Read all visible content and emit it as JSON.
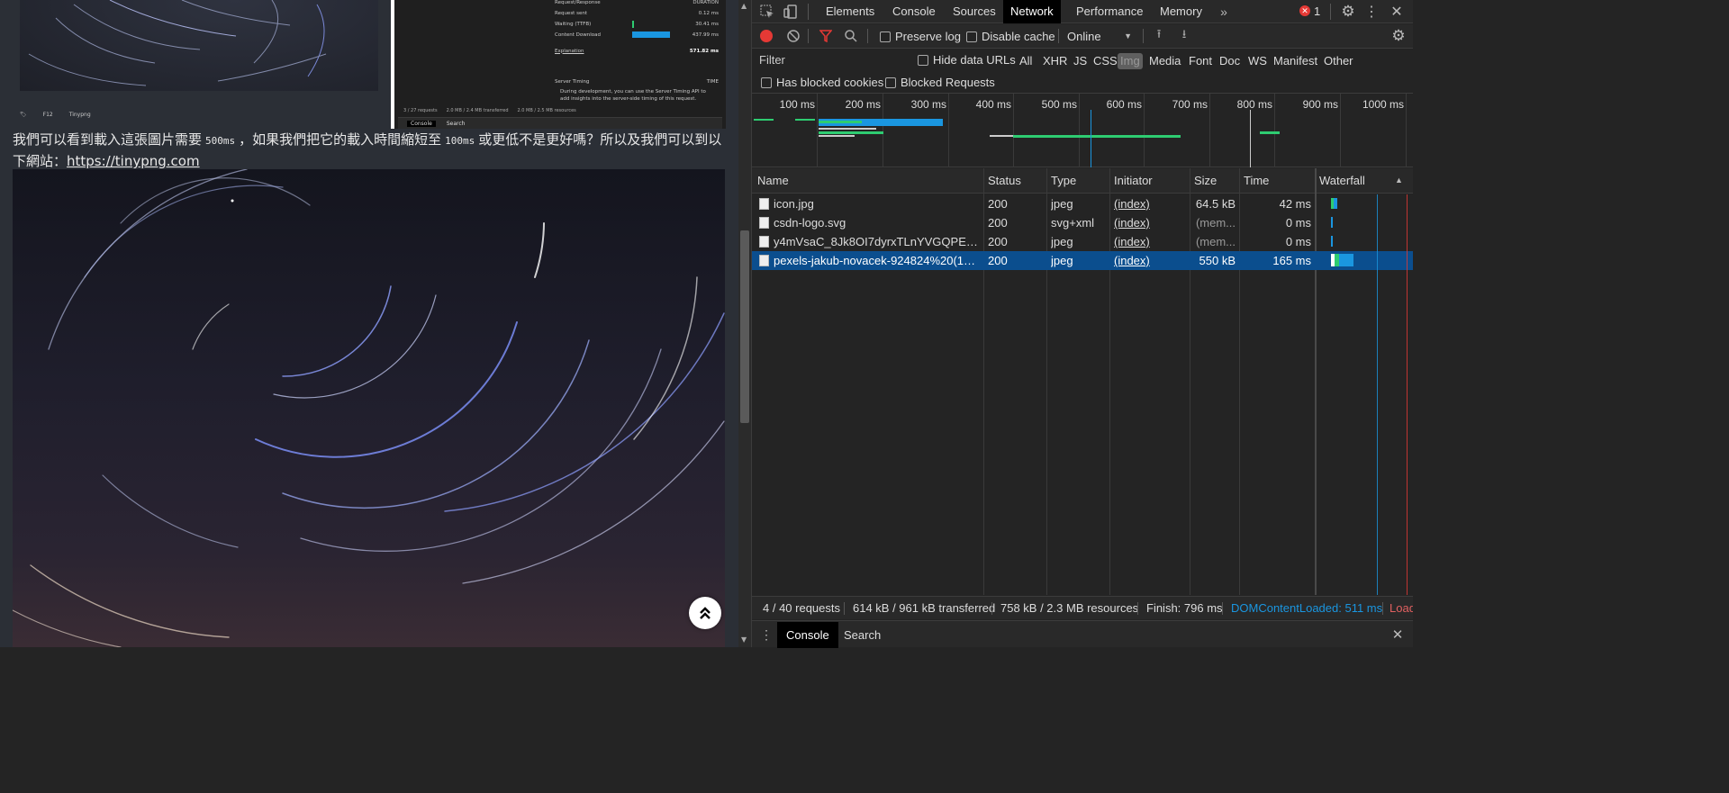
{
  "page": {
    "paragraph": {
      "part1": "我們可以看到載入這張圖片需要",
      "code1": "500ms",
      "part2": "，如果我們把它的載入時間縮短至",
      "code2": "100ms",
      "part3": "或更低不是更好嗎？所以及我們可以到以下網站：",
      "link": "https://tinypng.com"
    },
    "thumb_caption": [
      "F12",
      "Tinypng"
    ],
    "inner_screenshot": {
      "section": "Request/Response",
      "duration_label": "DURATION",
      "rows": [
        {
          "label": "Request sent",
          "value": "0.12 ms",
          "fill": 0.0
        },
        {
          "label": "Waiting (TTFB)",
          "value": "30.41 ms",
          "fill": 0.03
        },
        {
          "label": "Content Download",
          "value": "437.99 ms",
          "fill": 0.48
        }
      ],
      "explanation": "Explanation",
      "total": "571.82 ms",
      "server_timing": "Server Timing",
      "time_label": "TIME",
      "server_note": "During development, you can use the Server Timing API to add insights into the server-side timing of this request.",
      "status": [
        "3 / 27 requests",
        "2.0 MB / 2.4 MB transferred",
        "2.0 MB / 2.5 MB resources"
      ],
      "tabs": [
        "Console",
        "Search"
      ]
    }
  },
  "devtools": {
    "tabs": [
      "Elements",
      "Console",
      "Sources",
      "Network",
      "Performance",
      "Memory"
    ],
    "active_tab": "Network",
    "error_count": "1",
    "toolbar": {
      "preserve_log": "Preserve log",
      "disable_cache": "Disable cache",
      "throttle": "Online"
    },
    "filter": {
      "placeholder": "Filter",
      "hide_data_urls": "Hide data URLs",
      "types": [
        "All",
        "XHR",
        "JS",
        "CSS",
        "Img",
        "Media",
        "Font",
        "Doc",
        "WS",
        "Manifest",
        "Other"
      ],
      "selected_type": "Img",
      "has_blocked_cookies": "Has blocked cookies",
      "blocked_requests": "Blocked Requests"
    },
    "overview_ticks": [
      "100 ms",
      "200 ms",
      "300 ms",
      "400 ms",
      "500 ms",
      "600 ms",
      "700 ms",
      "800 ms",
      "900 ms",
      "1000 ms"
    ],
    "columns": [
      "Name",
      "Status",
      "Type",
      "Initiator",
      "Size",
      "Time",
      "Waterfall"
    ],
    "rows": [
      {
        "name": "icon.jpg",
        "status": "200",
        "type": "jpeg",
        "initiator": "(index)",
        "size": "64.5 kB",
        "time": "42 ms"
      },
      {
        "name": "csdn-logo.svg",
        "status": "200",
        "type": "svg+xml",
        "initiator": "(index)",
        "size": "(mem...",
        "time": "0 ms"
      },
      {
        "name": "y4mVsaC_8Jk8OI7dyrxTLnYVGQPE2mM...",
        "status": "200",
        "type": "jpeg",
        "initiator": "(index)",
        "size": "(mem...",
        "time": "0 ms"
      },
      {
        "name": "pexels-jakub-novacek-924824%20(1)%2...",
        "status": "200",
        "type": "jpeg",
        "initiator": "(index)",
        "size": "550 kB",
        "time": "165 ms"
      }
    ],
    "selected_row": 3,
    "status": {
      "requests": "4 / 40 requests",
      "transferred": "614 kB / 961 kB transferred",
      "resources": "758 kB / 2.3 MB resources",
      "finish": "Finish: 796 ms",
      "dom_loaded": "DOMContentLoaded: 511 ms",
      "load": "Load"
    },
    "drawer_tabs": [
      "Console",
      "Search"
    ],
    "colors": {
      "accent": "#1a96e0",
      "selected_row": "#0b4e8e",
      "green": "#2ecc71",
      "record": "#e53935"
    }
  }
}
